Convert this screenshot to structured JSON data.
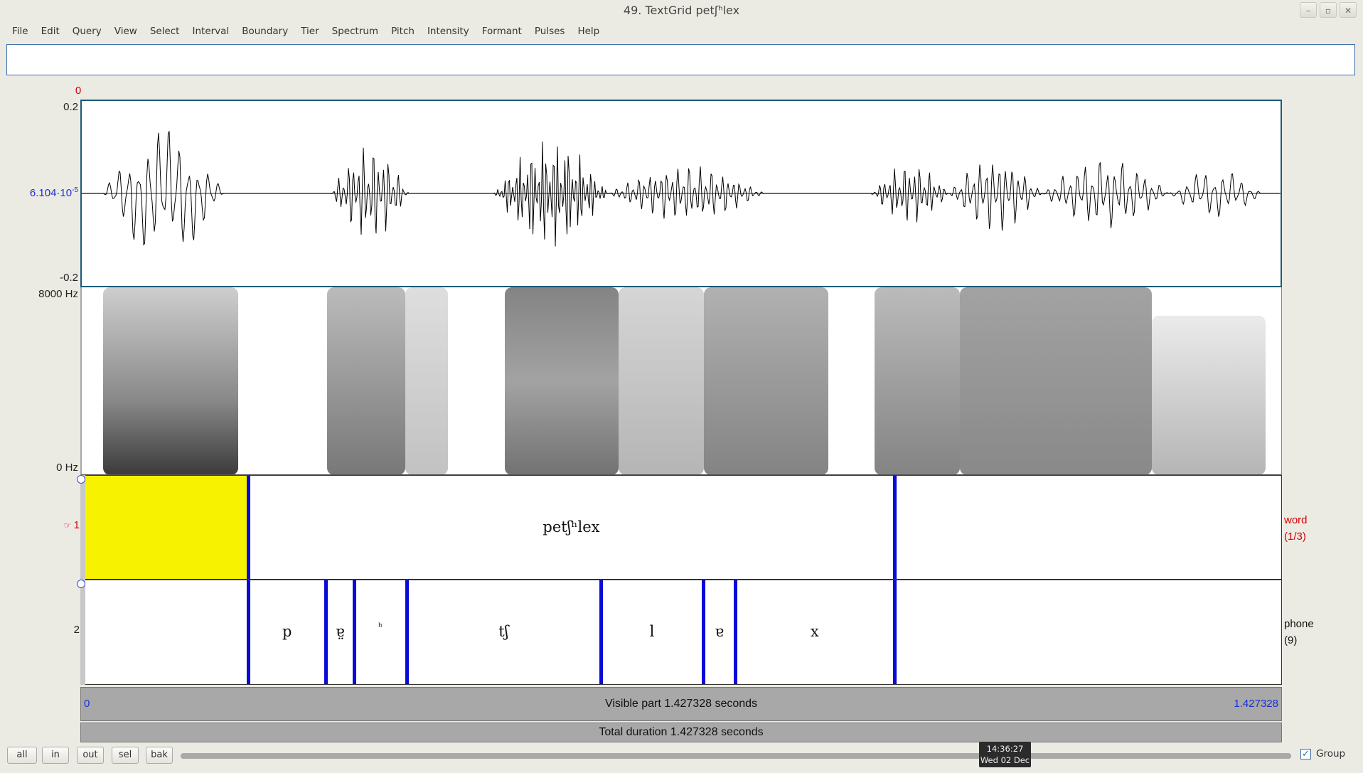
{
  "window": {
    "title": "49. TextGrid petʃʰlex",
    "controls": [
      "minimize-icon",
      "maximize-icon",
      "close-icon"
    ]
  },
  "menu": [
    "File",
    "Edit",
    "Query",
    "View",
    "Select",
    "Interval",
    "Boundary",
    "Tier",
    "Spectrum",
    "Pitch",
    "Intensity",
    "Formant",
    "Pulses",
    "Help"
  ],
  "query_field": {
    "value": "",
    "placeholder": ""
  },
  "cursor_time_label": "0",
  "waveform": {
    "y_top": "0.2",
    "y_mid": "6.104·10",
    "y_mid_exp": "-5",
    "y_bottom": "-0.2"
  },
  "spectrogram": {
    "top": "8000 Hz",
    "bottom": "0 Hz"
  },
  "tiers": [
    {
      "number": "1",
      "name": "word",
      "count": "(1/3)",
      "selected": true,
      "intervals": [
        {
          "text": "",
          "start": 0.0,
          "end": 0.199,
          "highlighted": true
        },
        {
          "text": "petʃʰlex",
          "start": 0.199,
          "end": 0.967
        },
        {
          "text": "",
          "start": 0.967,
          "end": 1.427328
        }
      ]
    },
    {
      "number": "2",
      "name": "phone",
      "count": "(9)",
      "intervals": [
        {
          "text": "",
          "start": 0.0,
          "end": 0.199
        },
        {
          "text": "p",
          "start": 0.199,
          "end": 0.291
        },
        {
          "text": "ɐ̤",
          "start": 0.291,
          "end": 0.325
        },
        {
          "text": "ʰ",
          "start": 0.325,
          "end": 0.387
        },
        {
          "text": "tʃ",
          "start": 0.387,
          "end": 0.618
        },
        {
          "text": "l",
          "start": 0.618,
          "end": 0.74
        },
        {
          "text": "ɐ",
          "start": 0.74,
          "end": 0.778
        },
        {
          "text": "x",
          "start": 0.778,
          "end": 0.967
        },
        {
          "text": "",
          "start": 0.967,
          "end": 1.427328
        }
      ]
    }
  ],
  "time_axis": {
    "start": "0",
    "end": "1.427328",
    "total_seconds": 1.427328
  },
  "visible_part": "Visible part 1.427328 seconds",
  "total_duration": "Total duration 1.427328 seconds",
  "buttons": {
    "all": "all",
    "in": "in",
    "out": "out",
    "sel": "sel",
    "bak": "bak"
  },
  "clock": {
    "time": "14:36:27",
    "date": "Wed 02 Dec"
  },
  "group": {
    "label": "Group",
    "checked": true
  },
  "colors": {
    "selection": "#f7f300",
    "boundary": "#0a0ad8",
    "axis_label": "#1b2fd6",
    "accent": "#d40000"
  }
}
